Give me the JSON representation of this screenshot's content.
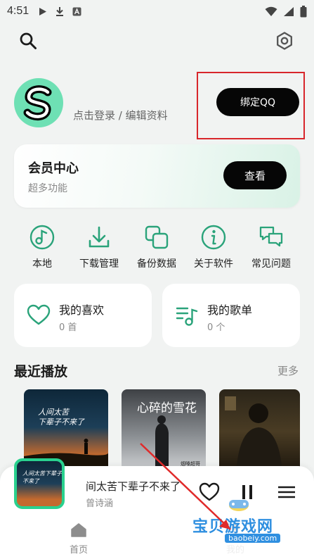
{
  "status_bar": {
    "time": "4:51"
  },
  "header": {
    "search_icon": "search-icon",
    "settings_icon": "gear-icon"
  },
  "profile": {
    "login_text": "点击登录 / 编辑资料",
    "bind_button": "绑定QQ"
  },
  "vip": {
    "title": "会员中心",
    "subtitle": "超多功能",
    "button": "查看"
  },
  "quick_actions": [
    {
      "label": "本地",
      "icon": "music-note-icon"
    },
    {
      "label": "下载管理",
      "icon": "download-icon"
    },
    {
      "label": "备份数据",
      "icon": "backup-icon"
    },
    {
      "label": "关于软件",
      "icon": "info-icon"
    },
    {
      "label": "常见问题",
      "icon": "chat-icon"
    }
  ],
  "library": {
    "favorites": {
      "title": "我的喜欢",
      "count": "0 首"
    },
    "playlists": {
      "title": "我的歌单",
      "count": "0 个"
    }
  },
  "recent": {
    "title": "最近播放",
    "more": "更多",
    "covers": [
      {
        "text_line1": "人间太苦",
        "text_line2": "下辈子不来了"
      },
      {
        "text": "心碎的雪花",
        "small": "烟嗓超哥"
      },
      {
        "text": ""
      }
    ]
  },
  "now_playing": {
    "title": "间太苦下辈子不来了",
    "artist": "曾诗涵",
    "cover_text": "人间太苦下辈子不来了"
  },
  "bottom_nav": [
    {
      "label": "首页"
    },
    {
      "label": "我的"
    }
  ],
  "watermark": {
    "text": "宝贝游戏网",
    "url": "baobeiy.com"
  },
  "colors": {
    "accent": "#29d18e",
    "button": "#060606",
    "highlight_box": "#d8262b"
  }
}
